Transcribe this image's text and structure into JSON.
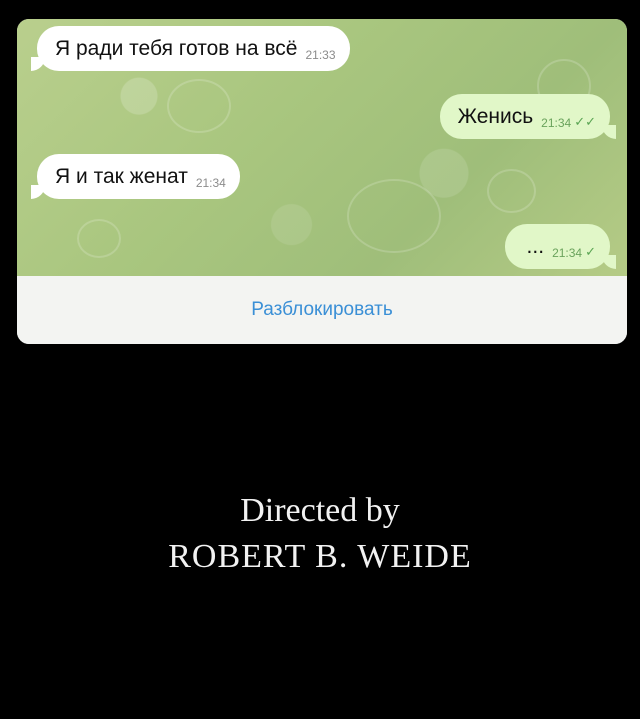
{
  "chat": {
    "messages": [
      {
        "direction": "incoming",
        "text": "Я ради тебя готов на всё",
        "time": "21:33"
      },
      {
        "direction": "outgoing",
        "text": "Женись",
        "time": "21:34",
        "status_icon": "double-check-icon"
      },
      {
        "direction": "incoming",
        "text": "Я и так женат",
        "time": "21:34"
      },
      {
        "direction": "outgoing",
        "text": "...",
        "time": "21:34",
        "status_icon": "check-icon"
      }
    ],
    "unblock_label": "Разблокировать"
  },
  "credits": {
    "line1": "Directed by",
    "line2": "ROBERT B. WEIDE"
  },
  "colors": {
    "background": "#000000",
    "incoming_bubble": "#ffffff",
    "outgoing_bubble": "#e1f7c8",
    "wallpaper": "#a9c67f",
    "link": "#3a8fd6",
    "credits_text": "#f2f2f2"
  }
}
